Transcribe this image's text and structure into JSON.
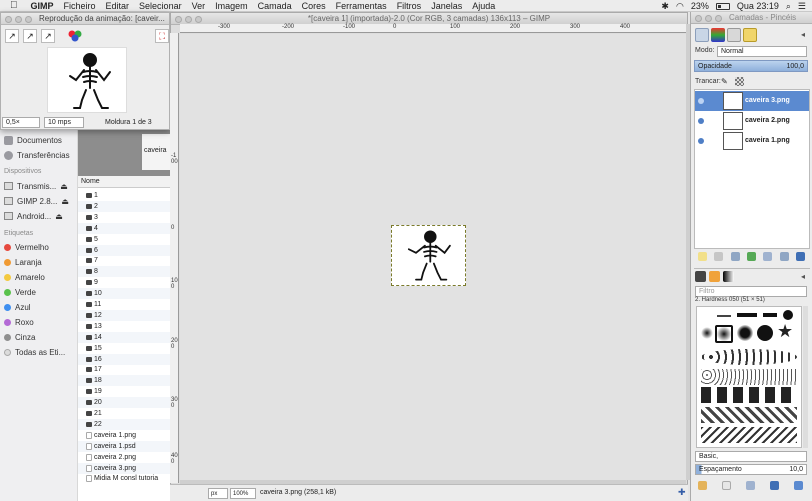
{
  "menubar": {
    "apple": "",
    "app": "GIMP",
    "items": [
      "Ficheiro",
      "Editar",
      "Selecionar",
      "Ver",
      "Imagem",
      "Camada",
      "Cores",
      "Ferramentas",
      "Filtros",
      "Janelas",
      "Ajuda"
    ],
    "battery": "23%",
    "clock": "Qua 23:19"
  },
  "playback": {
    "title": "Reprodução da animação: [caveir...",
    "zoom": "0,5×",
    "fps": "10 mps",
    "frame_label": "Moldura 1 de 3"
  },
  "finder": {
    "favorites": [
      {
        "label": "Documentos"
      },
      {
        "label": "Transferências"
      }
    ],
    "devices_header": "Dispositivos",
    "devices": [
      {
        "label": "Transmis..."
      },
      {
        "label": "GIMP 2.8..."
      },
      {
        "label": "Android..."
      }
    ],
    "tags_header": "Etiquetas",
    "tags": [
      {
        "label": "Vermelho",
        "color": "#e6493f"
      },
      {
        "label": "Laranja",
        "color": "#f09a33"
      },
      {
        "label": "Amarelo",
        "color": "#f3c940"
      },
      {
        "label": "Verde",
        "color": "#5ac24c"
      },
      {
        "label": "Azul",
        "color": "#3f8ff0"
      },
      {
        "label": "Roxo",
        "color": "#b46ad6"
      },
      {
        "label": "Cinza",
        "color": "#8f8f8f"
      },
      {
        "label": "Todas as Eti...",
        "color": "#dcdcdc"
      }
    ],
    "preview_caption": "caveira",
    "column_header": "Nome",
    "files": [
      "1",
      "2",
      "3",
      "4",
      "5",
      "6",
      "7",
      "8",
      "9",
      "10",
      "11",
      "12",
      "13",
      "14",
      "15",
      "16",
      "17",
      "18",
      "19",
      "20",
      "21",
      "22",
      "caveira 1.png",
      "caveira 1.psd",
      "caveira 2.png",
      "caveira 3.png",
      "Midia M consl tutoria"
    ]
  },
  "image_window": {
    "title": "*[caveira 1] (importada)-2.0 (Cor RGB, 3 camadas) 136x113 – GIMP",
    "ruler_h": [
      "-300",
      "-200",
      "-100",
      "0",
      "100",
      "200",
      "300",
      "400"
    ],
    "ruler_v": [
      "-100",
      "0",
      "100",
      "200",
      "300",
      "400",
      "500"
    ],
    "unit": "px",
    "zoom": "100%",
    "status": "caveira 3.png (258,1 kB)"
  },
  "dock": {
    "title": "Camadas - Pincéis",
    "mode_label": "Modo:",
    "mode_value": "Normal",
    "opacity_label": "Opacidade",
    "opacity_value": "100,0",
    "lock_label": "Trancar:",
    "layers": [
      {
        "name": "caveira 3.png"
      },
      {
        "name": "caveira 2.png"
      },
      {
        "name": "caveira 1.png"
      }
    ],
    "filter_placeholder": "Filtro",
    "brush_name": "2. Hardness 050 (51 × 51)",
    "brush_tag": "Basic,",
    "spacing_label": "Espaçamento",
    "spacing_value": "10,0"
  }
}
